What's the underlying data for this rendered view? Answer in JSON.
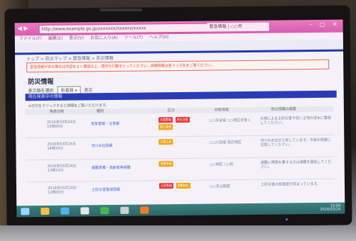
{
  "browser": {
    "address": "http://www.example.go.jp/xxxxxxx/xxxxxx/xxxxx",
    "tab_label": "緊急情報 | ○○市",
    "nav": "◀ ▶",
    "window_controls": "– ▢ ✕",
    "menu": [
      "ファイル(F)",
      "編集(E)",
      "表示(V)",
      "お気に入り(A)",
      "ツール(T)",
      "ヘルプ(H)"
    ]
  },
  "site": {
    "breadcrumb": "トップ > 防災マップ > 緊急情報 > 防災情報",
    "notice": "緊急情報がある場合は内容をよく確認の上、適切な行動をとってください。詳細情報は各リンク先をご覧ください。",
    "page_title": "防災情報",
    "sort_label": "表示順を選択",
    "sort_value": "新着順",
    "sort_button": "表示",
    "section_title": "現在発表中の情報",
    "hint": "※日付をクリックすると詳細をご覧いただけます。",
    "columns": [
      "発表日時",
      "種別",
      "区分",
      "対象地域",
      "防災情報の概要"
    ]
  },
  "rows": [
    {
      "date": "2016年03月24日 15時00分",
      "link": "気象警報・注意報",
      "badges": [
        {
          "label": "大雨警報",
          "color": "#e23c3c"
        },
        {
          "label": "洪水注意",
          "color": "#e23c3c"
        },
        {
          "label": "雷注意報",
          "color": "#f0a21a"
        }
      ],
      "loc": "○○市全域 ○○地区を除く",
      "desc": "大雨による土砂災害や低い土地の浸水に警戒してください。"
    },
    {
      "date": "2016年03月24日 14時30分",
      "link": "河川水位情報",
      "badges": [
        {
          "label": "氾濫注意",
          "color": "#f0a21a"
        }
      ],
      "loc": "○○川流域 周辺地区",
      "desc": "河川の水位が上昇しています。今後の情報に注意してください。"
    },
    {
      "date": "2016年03月24日 13時10分",
      "link": "避難準備・高齢者等避難",
      "badges": [
        {
          "label": "避難準備",
          "color": "#f0a21a"
        }
      ],
      "loc": "○○地区 ○○町",
      "desc": "避難に時間を要する方は避難を開始してください。"
    },
    {
      "date": "2016年03月24日 12時00分",
      "link": "土砂災害警戒情報",
      "badges": [
        {
          "label": "土砂警戒",
          "color": "#e23c3c"
        },
        {
          "label": "避難勧告",
          "color": "#f0a21a"
        }
      ],
      "loc": "○○市山間部",
      "desc": "土砂災害の危険度が高まっています。"
    }
  ],
  "taskbar": {
    "clock_time": "15:04",
    "clock_date": "2016/03/24"
  }
}
